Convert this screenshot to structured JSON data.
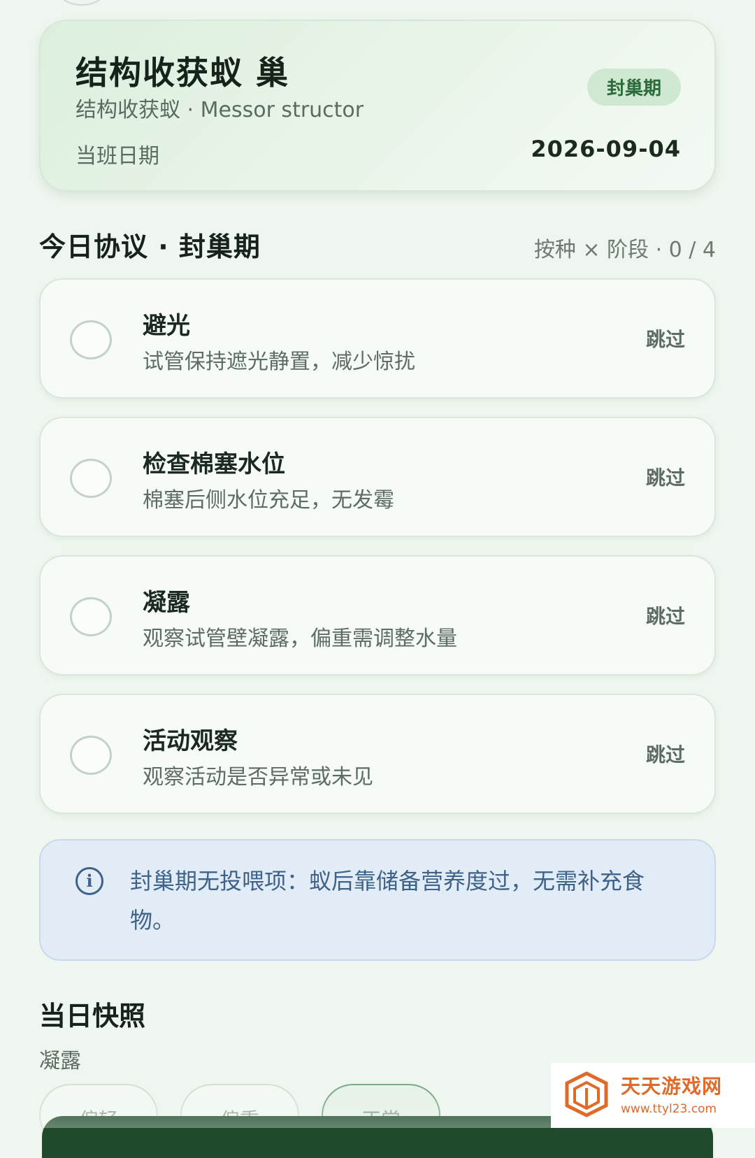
{
  "header": {
    "title": "结构收获蚁 巢",
    "subtitle": "结构收获蚁 · Messor structor",
    "stage_badge": "封巢期",
    "duty_label": "当班日期",
    "duty_date": "2026-09-04"
  },
  "protocol": {
    "title": "今日协议 · 封巢期",
    "meta": "按种 × 阶段 · 0 / 4",
    "completed": 0,
    "total": 4,
    "tasks": [
      {
        "title": "避光",
        "desc": "试管保持遮光静置，减少惊扰",
        "skip": "跳过",
        "done": false
      },
      {
        "title": "检查棉塞水位",
        "desc": "棉塞后侧水位充足，无发霉",
        "skip": "跳过",
        "done": false
      },
      {
        "title": "凝露",
        "desc": "观察试管壁凝露，偏重需调整水量",
        "skip": "跳过",
        "done": false
      },
      {
        "title": "活动观察",
        "desc": "观察活动是否异常或未见",
        "skip": "跳过",
        "done": false
      }
    ]
  },
  "notice": {
    "icon": "info-icon",
    "text": "封巢期无投喂项：蚁后靠储备营养度过，无需补充食物。"
  },
  "snapshot": {
    "title": "当日快照",
    "label": "凝露",
    "options": [
      "偏轻",
      "偏重",
      "正常"
    ],
    "selected": "正常"
  },
  "watermark": {
    "name": "天天游戏网",
    "url": "www.ttyl23.com"
  },
  "colors": {
    "background": "#eef6ef",
    "accent_green": "#2b6a3a",
    "info_blue": "#3f6288",
    "bottom_bar": "#1f4a2c"
  }
}
